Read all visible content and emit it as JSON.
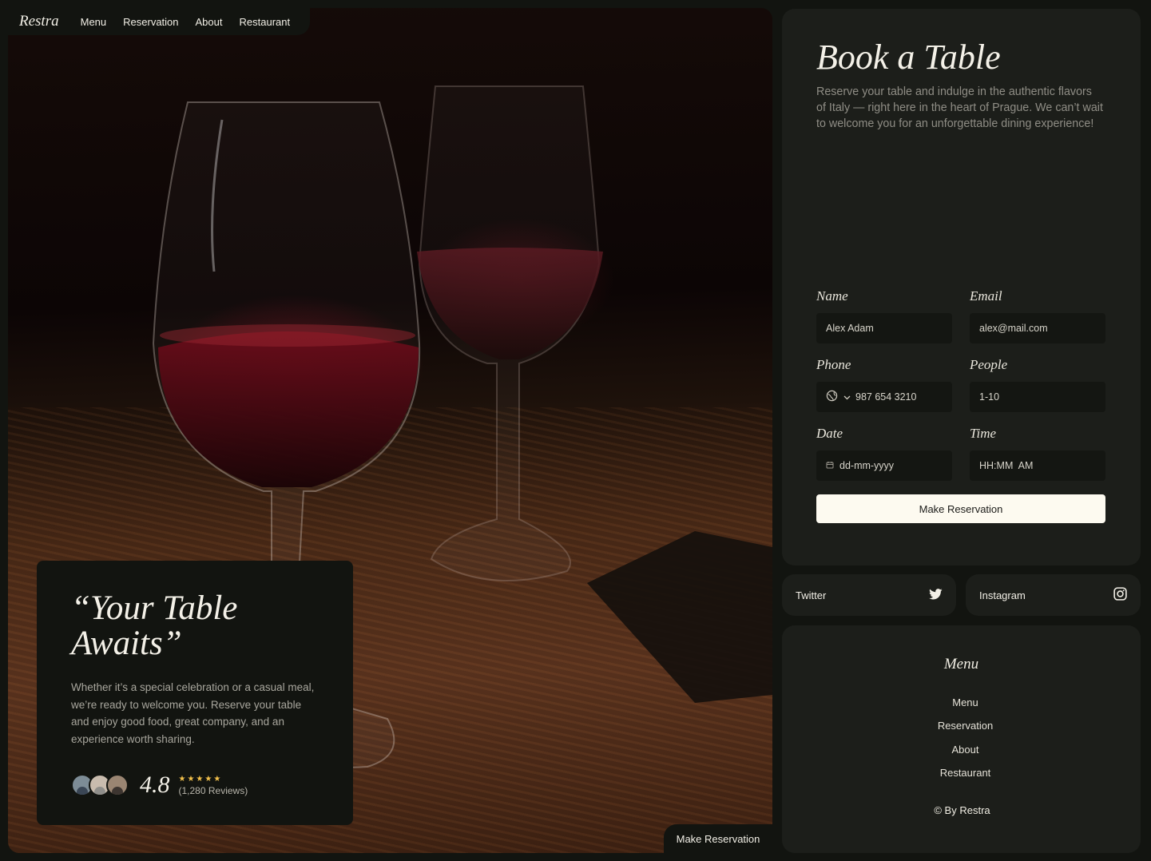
{
  "brand": {
    "logo": "Restra"
  },
  "nav": {
    "items": [
      {
        "label": "Menu"
      },
      {
        "label": "Reservation"
      },
      {
        "label": "About"
      },
      {
        "label": "Restaurant"
      }
    ]
  },
  "hero": {
    "image_description": "wine-glasses-on-wooden-table",
    "quote_title": "“Your Table Awaits”",
    "quote_body": "Whether it’s a special celebration or a casual meal, we’re ready to welcome you. Reserve your table and enjoy good food, great company, and an experience worth sharing.",
    "rating": "4.8",
    "stars": "★★★★★",
    "reviews": "(1,280 Reviews)",
    "avatar_colors": [
      "#6b7f8e",
      "#b8a89a",
      "#8a7462"
    ],
    "cta_label": "Make Reservation"
  },
  "booking": {
    "title": "Book a Table",
    "subtitle": "Reserve your table and indulge in the authentic flavors of Italy — right here in the heart of Prague. We can’t wait to welcome you for an unforgettable dining experience!",
    "fields": {
      "name": {
        "label": "Name",
        "value": "Alex Adam"
      },
      "email": {
        "label": "Email",
        "value": "alex@mail.com"
      },
      "phone": {
        "label": "Phone",
        "value": "987 654 3210",
        "icon": "globe-icon"
      },
      "people": {
        "label": "People",
        "value": "1-10"
      },
      "date": {
        "label": "Date",
        "value": "dd-mm-yyyy",
        "icon": "calendar-icon"
      },
      "time": {
        "label": "Time",
        "value": "HH:MM  AM"
      }
    },
    "submit_label": "Make Reservation"
  },
  "social": {
    "twitter": {
      "label": "Twitter",
      "icon": "twitter-icon"
    },
    "instagram": {
      "label": "Instagram",
      "icon": "instagram-icon"
    }
  },
  "footer": {
    "title": "Menu",
    "links": [
      {
        "label": "Menu"
      },
      {
        "label": "Reservation"
      },
      {
        "label": "About"
      },
      {
        "label": "Restaurant"
      }
    ],
    "copyright": "© By Restra"
  },
  "colors": {
    "background": "#121410",
    "panel": "#1c1e1a",
    "input": "#141612",
    "button": "#fdfaf0",
    "star": "#f3c14b"
  }
}
